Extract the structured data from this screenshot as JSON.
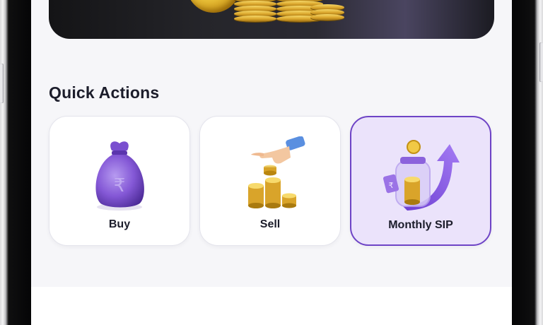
{
  "hero": {
    "theme": "gold-coins-banner"
  },
  "quick_actions": {
    "title": "Quick Actions",
    "items": [
      {
        "label": "Buy",
        "icon": "money-bag-icon",
        "selected": false
      },
      {
        "label": "Sell",
        "icon": "hand-coins-icon",
        "selected": false
      },
      {
        "label": "Monthly SIP",
        "icon": "jar-growth-icon",
        "selected": true
      }
    ]
  },
  "colors": {
    "accent": "#6e44c6",
    "selected_card_bg": "#ebe3fb",
    "title_text": "#1c1d2b",
    "screen_bg": "#f6f6f9"
  }
}
